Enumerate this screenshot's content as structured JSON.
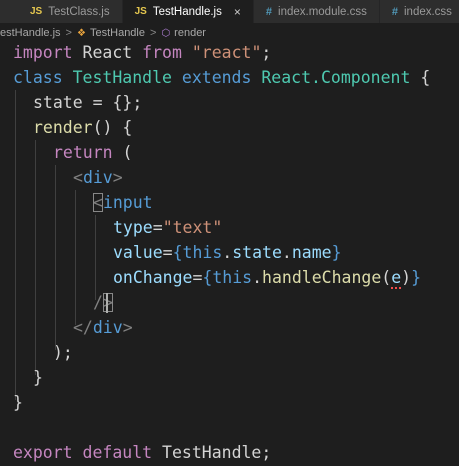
{
  "tabs": [
    {
      "icon": "JS",
      "label": "TestClass.js",
      "active": false
    },
    {
      "icon": "JS",
      "label": "TestHandle.js",
      "active": true,
      "close": "×"
    },
    {
      "icon": "#",
      "label": "index.module.css",
      "active": false
    },
    {
      "icon": "#",
      "label": "index.css",
      "active": false
    }
  ],
  "breadcrumb": {
    "file": "estHandle.js",
    "sep": ">",
    "component": "TestHandle",
    "method": "render"
  },
  "code": {
    "l1": {
      "kw": "import",
      "id": " React ",
      "from": "from",
      "str": " \"react\"",
      "end": ";"
    },
    "l2": {
      "kw1": "class",
      "name": " TestHandle",
      "kw2": " extends",
      "base": " React.Component",
      "end": " {"
    },
    "l3": {
      "text": "state = {};"
    },
    "l4": {
      "fn": "render",
      "rest": "() {"
    },
    "l5": {
      "kw": "return",
      "rest": " ("
    },
    "l6": {
      "open": "<",
      "tag": "div",
      "close": ">"
    },
    "l7": {
      "open": "<",
      "tag": "input"
    },
    "l8": {
      "attr": "type",
      "eq": "=",
      "val": "\"text\""
    },
    "l9": {
      "attr": "value",
      "eq": "=",
      "lb": "{",
      "this": "this",
      "dot1": ".",
      "state": "state",
      "dot2": ".",
      "name": "name",
      "rb": "}"
    },
    "l10": {
      "attr": "onChange",
      "eq": "=",
      "lb": "{",
      "this": "this",
      "dot": ".",
      "fn": "handleChange",
      "lp": "(",
      "arg": "e",
      "rp": ")",
      "rb": "}"
    },
    "l11": {
      "slash": "/",
      "close": ">"
    },
    "l12": {
      "open": "</",
      "tag": "div",
      "close": ">"
    },
    "l13": {
      "text": ");"
    },
    "l14": {
      "text": "}"
    },
    "l15": {
      "text": "}"
    },
    "l17": {
      "kw1": "export",
      "kw2": " default",
      "id": " TestHandle",
      "end": ";"
    }
  }
}
